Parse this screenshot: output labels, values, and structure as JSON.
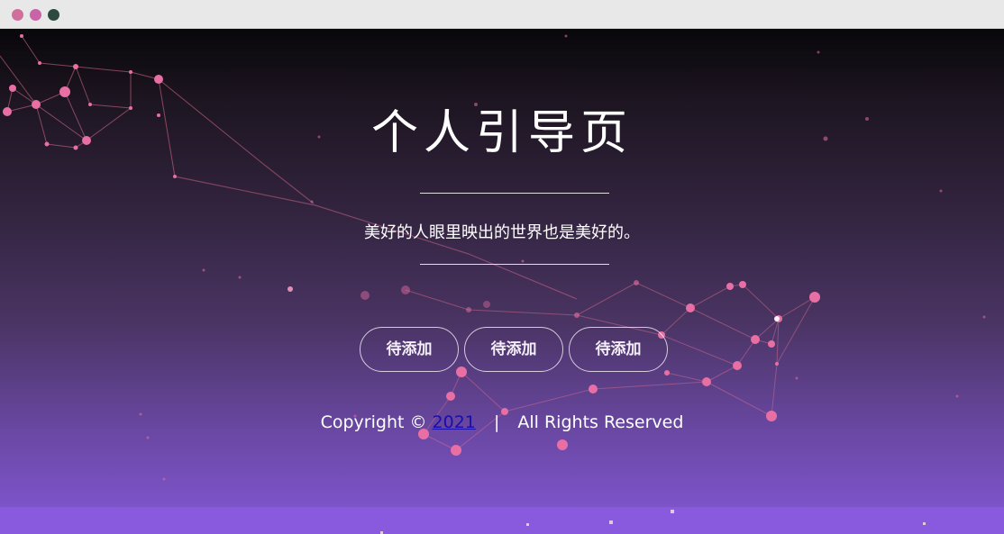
{
  "window": {
    "traffic_lights": [
      "#d06f9c",
      "#c864a7",
      "#2e4a3f"
    ]
  },
  "page": {
    "title": "个人引导页",
    "subtitle": "美好的人眼里映出的世界也是美好的。",
    "buttons": [
      "待添加",
      "待添加",
      "待添加"
    ]
  },
  "footer": {
    "copyright_prefix": "Copyright ©",
    "year_link": "2021",
    "separator": "|",
    "rights": "All Rights Reserved"
  },
  "colors": {
    "particle": "#e86fa3",
    "line": "#e0708f",
    "bg_top": "#08070a",
    "bg_bottom": "#8458d6"
  }
}
